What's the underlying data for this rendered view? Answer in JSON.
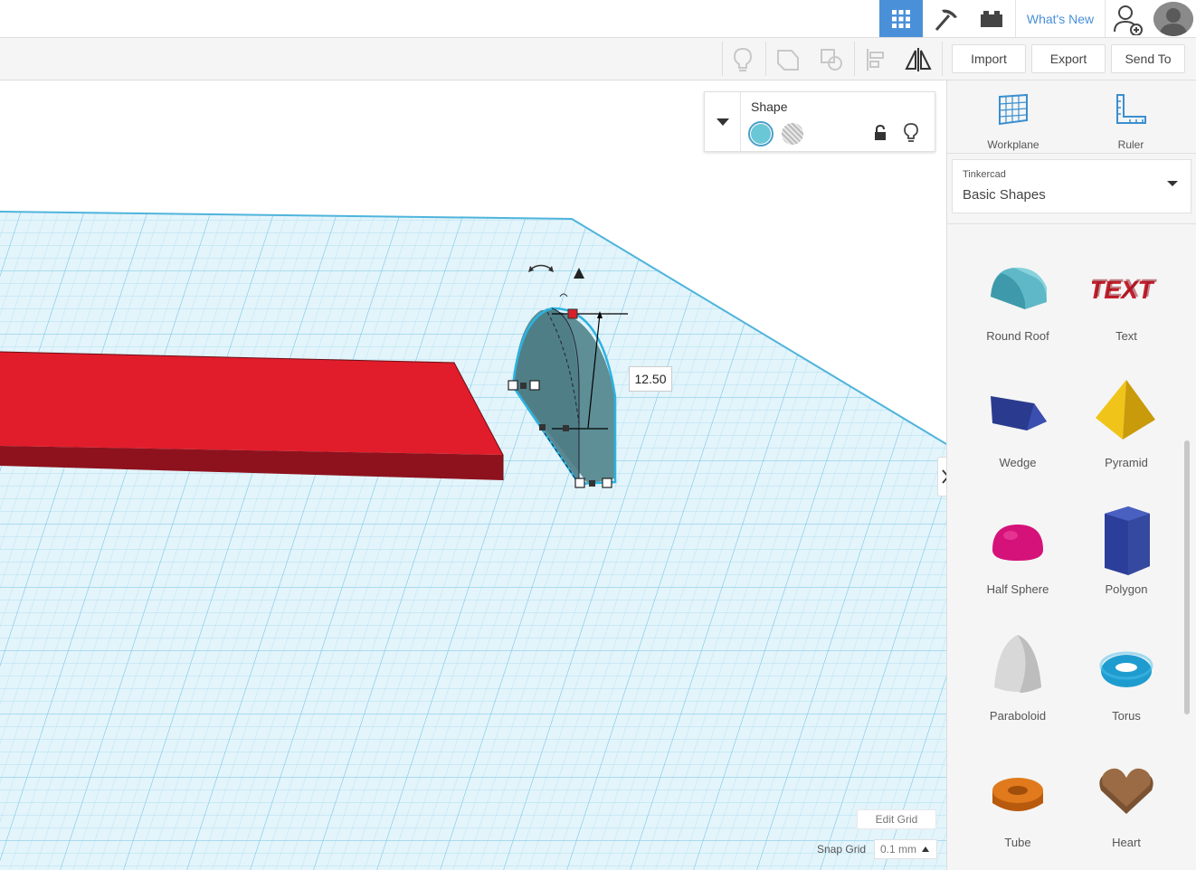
{
  "topbar": {
    "whats_new": "What's New",
    "icons": [
      "grid-view-icon",
      "pickaxe-icon",
      "brick-icon",
      "add-user-icon",
      "avatar"
    ]
  },
  "toolbar": {
    "import_label": "Import",
    "export_label": "Export",
    "send_to_label": "Send To",
    "icons": [
      "bulb-icon",
      "group-icon",
      "ungroup-icon",
      "align-icon",
      "mirror-icon"
    ]
  },
  "shape_panel": {
    "title": "Shape",
    "solid_color": "#6ac7d6"
  },
  "viewport": {
    "dimension_value": "12.50",
    "edit_grid_label": "Edit Grid",
    "snap_grid_label": "Snap Grid",
    "snap_grid_value": "0.1 mm"
  },
  "sidebar": {
    "workplane_label": "Workplane",
    "ruler_label": "Ruler",
    "library": {
      "provider": "Tinkercad",
      "selected": "Basic Shapes"
    },
    "shapes": [
      {
        "label": "Round Roof",
        "color": "#5fb8c7"
      },
      {
        "label": "Text",
        "color": "#c8202d"
      },
      {
        "label": "Wedge",
        "color": "#2a3b8f"
      },
      {
        "label": "Pyramid",
        "color": "#f0c419"
      },
      {
        "label": "Half Sphere",
        "color": "#d4127a"
      },
      {
        "label": "Polygon",
        "color": "#2a3e9a"
      },
      {
        "label": "Paraboloid",
        "color": "#d8d8d8"
      },
      {
        "label": "Torus",
        "color": "#1f9ccf"
      },
      {
        "label": "Tube",
        "color": "#e07a1c"
      },
      {
        "label": "Heart",
        "color": "#9a6b44"
      }
    ]
  },
  "colors": {
    "accent": "#4a90d9",
    "grid_blue": "#7ccbe6",
    "red_box": "#e11d2b",
    "selected_shape": "#5e8e96"
  }
}
